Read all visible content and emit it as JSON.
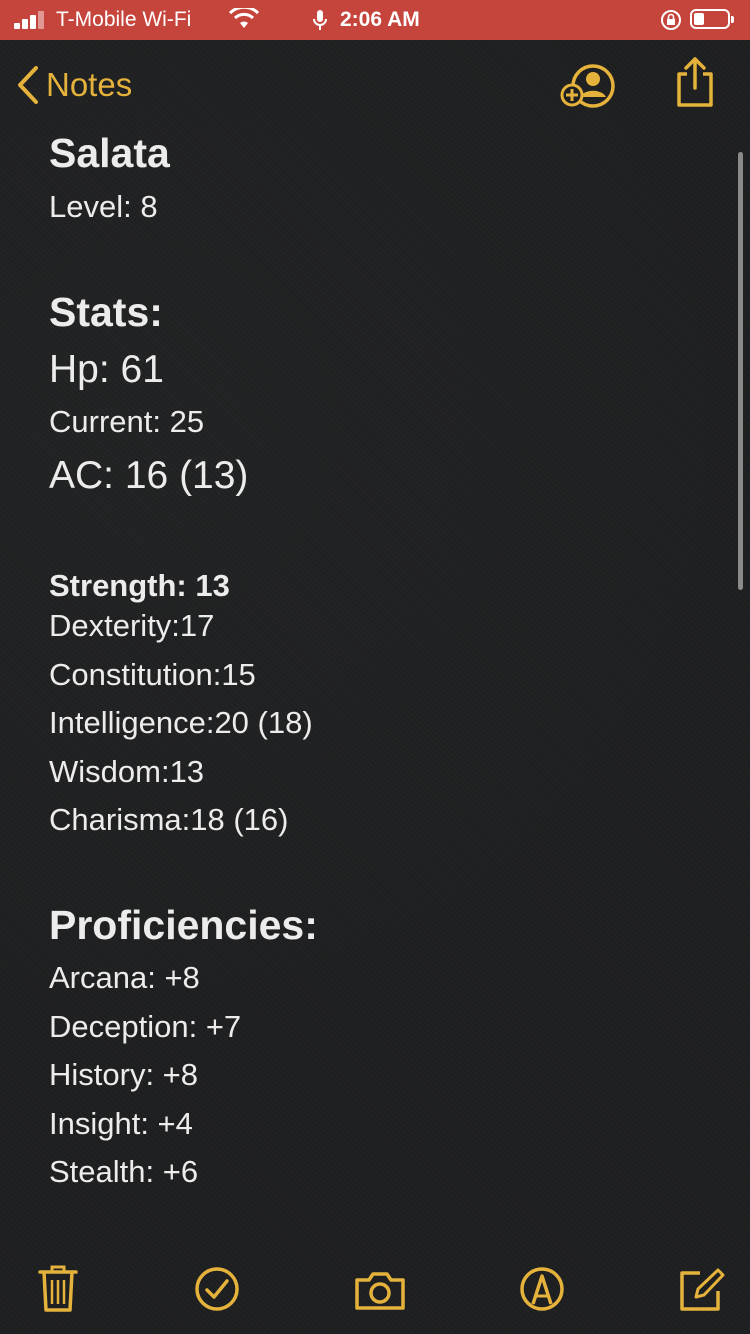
{
  "status_bar": {
    "carrier": "T-Mobile Wi-Fi",
    "time": "2:06 AM"
  },
  "nav": {
    "back_label": "Notes"
  },
  "note": {
    "title": "Salata",
    "level": "Level: 8",
    "stats_heading": "Stats:",
    "hp": "Hp: 61",
    "current": "Current: 25",
    "ac": "AC: 16 (13)",
    "abilities": [
      "Strength: 13",
      "Dexterity:17",
      "Constitution:15",
      "Intelligence:20 (18)",
      "Wisdom:13",
      "Charisma:18 (16)"
    ],
    "proficiencies_heading": "Proficiencies:",
    "proficiencies": [
      "Arcana: +8",
      "Deception: +7",
      "History: +8",
      "Insight: +4",
      "Stealth: +6"
    ]
  },
  "colors": {
    "accent": "#e5b23b",
    "status_bar": "#c5443b",
    "background": "#1e1f20"
  },
  "icons": [
    "back-chevron-icon",
    "add-person-icon",
    "share-icon",
    "trash-icon",
    "checklist-icon",
    "camera-icon",
    "markup-icon",
    "compose-icon"
  ]
}
